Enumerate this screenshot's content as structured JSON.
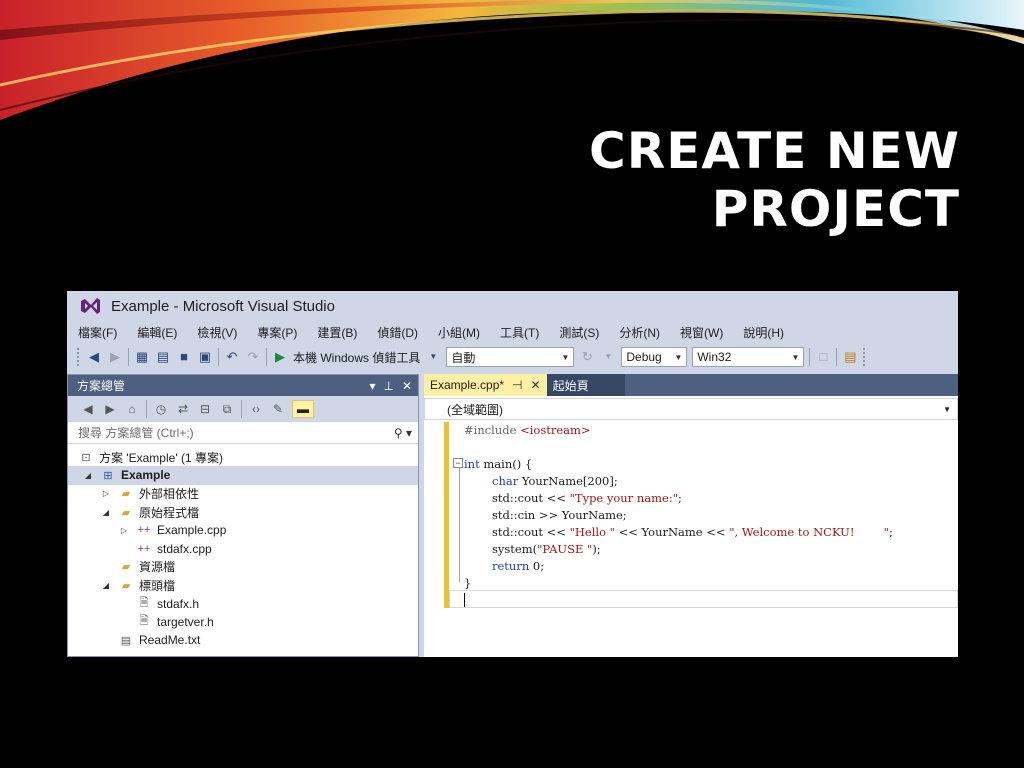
{
  "slide": {
    "title": "CREATE NEW PROJECT"
  },
  "window": {
    "title": "Example - Microsoft Visual Studio"
  },
  "menu": [
    "檔案(F)",
    "編輯(E)",
    "檢視(V)",
    "專案(P)",
    "建置(B)",
    "偵錯(D)",
    "小組(M)",
    "工具(T)",
    "測試(S)",
    "分析(N)",
    "視窗(W)",
    "說明(H)"
  ],
  "toolbar": {
    "run_label": "本機 Windows 偵錯工具",
    "auto_value": "自動",
    "config_value": "Debug",
    "platform_value": "Win32"
  },
  "solution_explorer": {
    "title": "方案總管",
    "search_placeholder": "搜尋 方案總管 (Ctrl+;)",
    "tree": [
      {
        "label": "方案 'Example' (1 專案)",
        "icon": "solution-icon"
      },
      {
        "label": "Example",
        "icon": "project-icon",
        "selected": true
      },
      {
        "label": "外部相依性",
        "icon": "folder-icon"
      },
      {
        "label": "原始程式檔",
        "icon": "folder-icon"
      },
      {
        "label": "Example.cpp",
        "icon": "cpp-file-icon"
      },
      {
        "label": "stdafx.cpp",
        "icon": "cpp-file-icon"
      },
      {
        "label": "資源檔",
        "icon": "folder-icon"
      },
      {
        "label": "標頭檔",
        "icon": "folder-icon"
      },
      {
        "label": "stdafx.h",
        "icon": "header-file-icon"
      },
      {
        "label": "targetver.h",
        "icon": "header-file-icon"
      },
      {
        "label": "ReadMe.txt",
        "icon": "text-file-icon"
      }
    ]
  },
  "editor": {
    "tabs": [
      {
        "label": "Example.cpp*"
      },
      {
        "label": "起始頁"
      }
    ],
    "scope": "(全域範圍)",
    "code": {
      "include_kw": "#include",
      "include_target": "<iostream>",
      "main_kw": "int",
      "main_rest": " main() {",
      "line3_kw": "char",
      "line3_rest": " YourName[200];",
      "line4_pre": "std::cout << ",
      "line4_str": "\"Type your name:\"",
      "line4_post": ";",
      "line5": "std::cin >> YourName;",
      "line6_pre": "std::cout << ",
      "line6_str1": "\"Hello \"",
      "line6_mid": " << YourName << ",
      "line6_str2": "\", Welcome to NCKU!        \"",
      "line6_post": ";",
      "line7_pre": "system(",
      "line7_str": "\"PAUSE \"",
      "line7_post": ");",
      "line8_kw": "return",
      "line8_rest": " 0;",
      "line9": "}"
    }
  }
}
